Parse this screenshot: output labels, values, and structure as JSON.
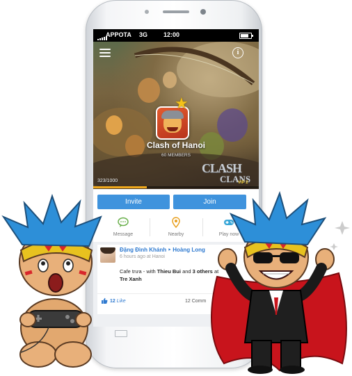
{
  "status_bar": {
    "carrier": "APPOTA",
    "network": "3G",
    "time": "12:00"
  },
  "banner": {
    "clan_name": "Clash of Hanoi",
    "members": "60 MEMBERS",
    "progress_text": "323/1000",
    "progress_fraction": 0.323,
    "logo_line1": "CLASH",
    "logo_line2": "CLANS",
    "logo_badge": "VIP 2"
  },
  "actions": {
    "invite_label": "Invite",
    "join_label": "Join",
    "secondary": [
      {
        "label": "Message",
        "icon": "message-icon"
      },
      {
        "label": "Nearby",
        "icon": "location-pin-icon"
      },
      {
        "label": "Play now",
        "icon": "gamepad-icon"
      }
    ]
  },
  "feed": {
    "post": {
      "author": "Đặng Đình Khánh ‣ Hoàng Long",
      "meta": "6 hours ago at Hanoi",
      "body_prefix": "Cafe trưa - with",
      "tagged_1": "Thieu Bui",
      "body_and": "and",
      "tagged_others": "3 others",
      "body_at": "at",
      "place": "Tre Xanh",
      "likes": "12",
      "likes_label": "Like",
      "comments": "12 Comm"
    }
  },
  "colors": {
    "accent_blue": "#3f93dd",
    "link_blue": "#2f7ad0",
    "progress_orange": "#f0a81c",
    "star_yellow": "#f4c21a",
    "cape_red": "#c8141c"
  }
}
